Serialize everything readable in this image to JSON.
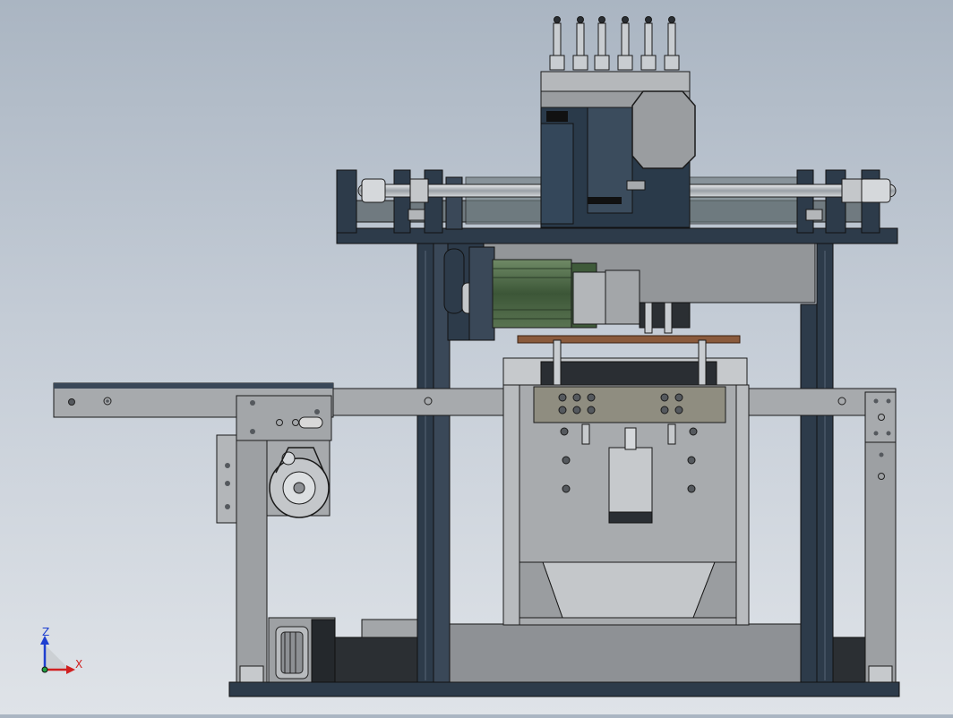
{
  "viewport": {
    "background_top": "#aab5c2",
    "background_bottom": "#dfe3e8"
  },
  "colors": {
    "frame_dark": "#2d3b4a",
    "plate_gray": "#8f9296",
    "plate_light": "#b3b6b9",
    "motor_green": "#3f5a3a",
    "rod_silver": "#c9cdd1",
    "outline": "#1a1a1a",
    "bolt": "#55595e",
    "copper_bar": "#8a5a3c"
  },
  "orientation_triad": {
    "x_label": "X",
    "z_label": "Z",
    "x_color": "#d02020",
    "z_color": "#1e3fd0",
    "icon": "coordinate-triad-icon"
  }
}
